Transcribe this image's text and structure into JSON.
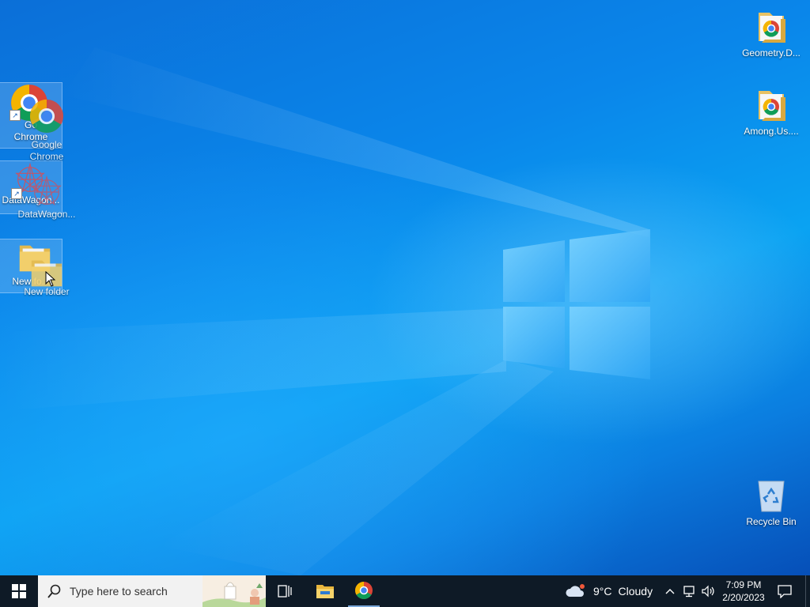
{
  "desktop": {
    "icons": [
      {
        "label": "Geometry.D...",
        "type": "folder-chrome"
      },
      {
        "label": "Among.Us....",
        "type": "folder-chrome"
      },
      {
        "label": "Recycle Bin",
        "type": "recycle-bin"
      },
      {
        "label": "Google Chrome",
        "label_line1": "Go",
        "label_line2": "Chrome",
        "type": "chrome-shortcut",
        "selected": true
      },
      {
        "label": "DataWagon...",
        "label_short": "DataWagon...",
        "type": "datawagon-shortcut",
        "selected": true
      },
      {
        "label": "New folder",
        "label_short": "New fo...",
        "type": "folder",
        "selected": true
      }
    ],
    "drag_ghosts": [
      {
        "label_line1": "Google",
        "label_line2": "Chrome"
      },
      {
        "label": "DataWagon..."
      },
      {
        "label": "New folder"
      }
    ]
  },
  "taskbar": {
    "search_placeholder": "Type here to search",
    "weather": {
      "temp": "9°C",
      "condition": "Cloudy"
    },
    "clock": {
      "time": "7:09 PM",
      "date": "2/20/2023"
    }
  },
  "colors": {
    "taskbar": "#0e1a26",
    "accent": "#0a86ea"
  }
}
